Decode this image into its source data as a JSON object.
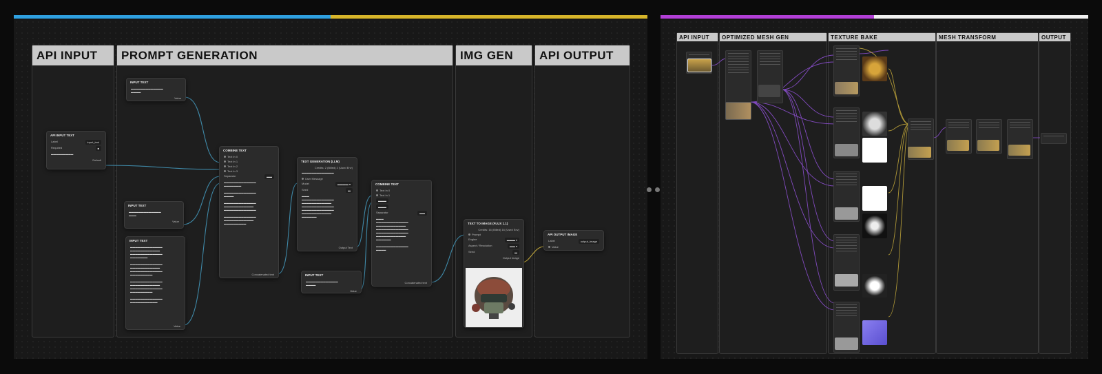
{
  "left_panel": {
    "groups": [
      "API INPUT",
      "PROMPT GENERATION",
      "IMG GEN",
      "API OUTPUT"
    ],
    "nodes": {
      "api_input": {
        "title": "API INPUT TEXT",
        "label_key": "Label",
        "label_val": "input_text",
        "required_key": "Required",
        "default_key": "Default"
      },
      "input_text_1": {
        "title": "INPUT TEXT",
        "value_key": "Value"
      },
      "input_text_2": {
        "title": "INPUT TEXT",
        "value_key": "Value"
      },
      "input_text_3": {
        "title": "INPUT TEXT",
        "value_key": "Value"
      },
      "input_text_4": {
        "title": "INPUT TEXT",
        "value_key": "Value"
      },
      "combine_1": {
        "title": "COMBINE TEXT",
        "inputs": [
          "Text In 0",
          "Text In 1",
          "Text In 2",
          "Text In 3"
        ],
        "separator_key": "Separator",
        "out_key": "Concatenated text"
      },
      "text_gen": {
        "title": "TEXT GENERATION (LLM)",
        "subtitle": "Credits: 2 (Billed) 2 (Used Env)",
        "rows": [
          "User Message",
          "Model",
          "Seed"
        ],
        "out_key": "Output Text"
      },
      "combine_2": {
        "title": "COMBINE TEXT",
        "inputs": [
          "Text In 0",
          "Text In 1"
        ],
        "separator_key": "Separator",
        "out_key": "Concatenated text"
      },
      "text_to_image": {
        "title": "TEXT TO IMAGE (FLUX 1.1)",
        "subtitle": "Credits: 16 (Billed) 16 (Used Env)",
        "rows": [
          "Prompt",
          "Engine",
          "Aspect / Resolution",
          "Seed"
        ],
        "out_key": "Output Image"
      },
      "api_output": {
        "title": "API OUTPUT IMAGE",
        "label_key": "Label",
        "label_val": "output_image",
        "value_key": "Value"
      }
    }
  },
  "right_panel": {
    "groups": [
      "API INPUT",
      "OPTIMIZED MESH GEN",
      "TEXTURE BAKE",
      "MESH TRANSFORM",
      "OUTPUT"
    ]
  },
  "colors": {
    "bar_blue": "#2fa0e0",
    "bar_yellow": "#d7b52a",
    "bar_purple": "#b23fd6",
    "bar_white": "#f0f0f0",
    "wire_blue": "#3f89a8",
    "wire_yellow": "#bfa53a",
    "wire_purple": "#8c4fd0"
  }
}
